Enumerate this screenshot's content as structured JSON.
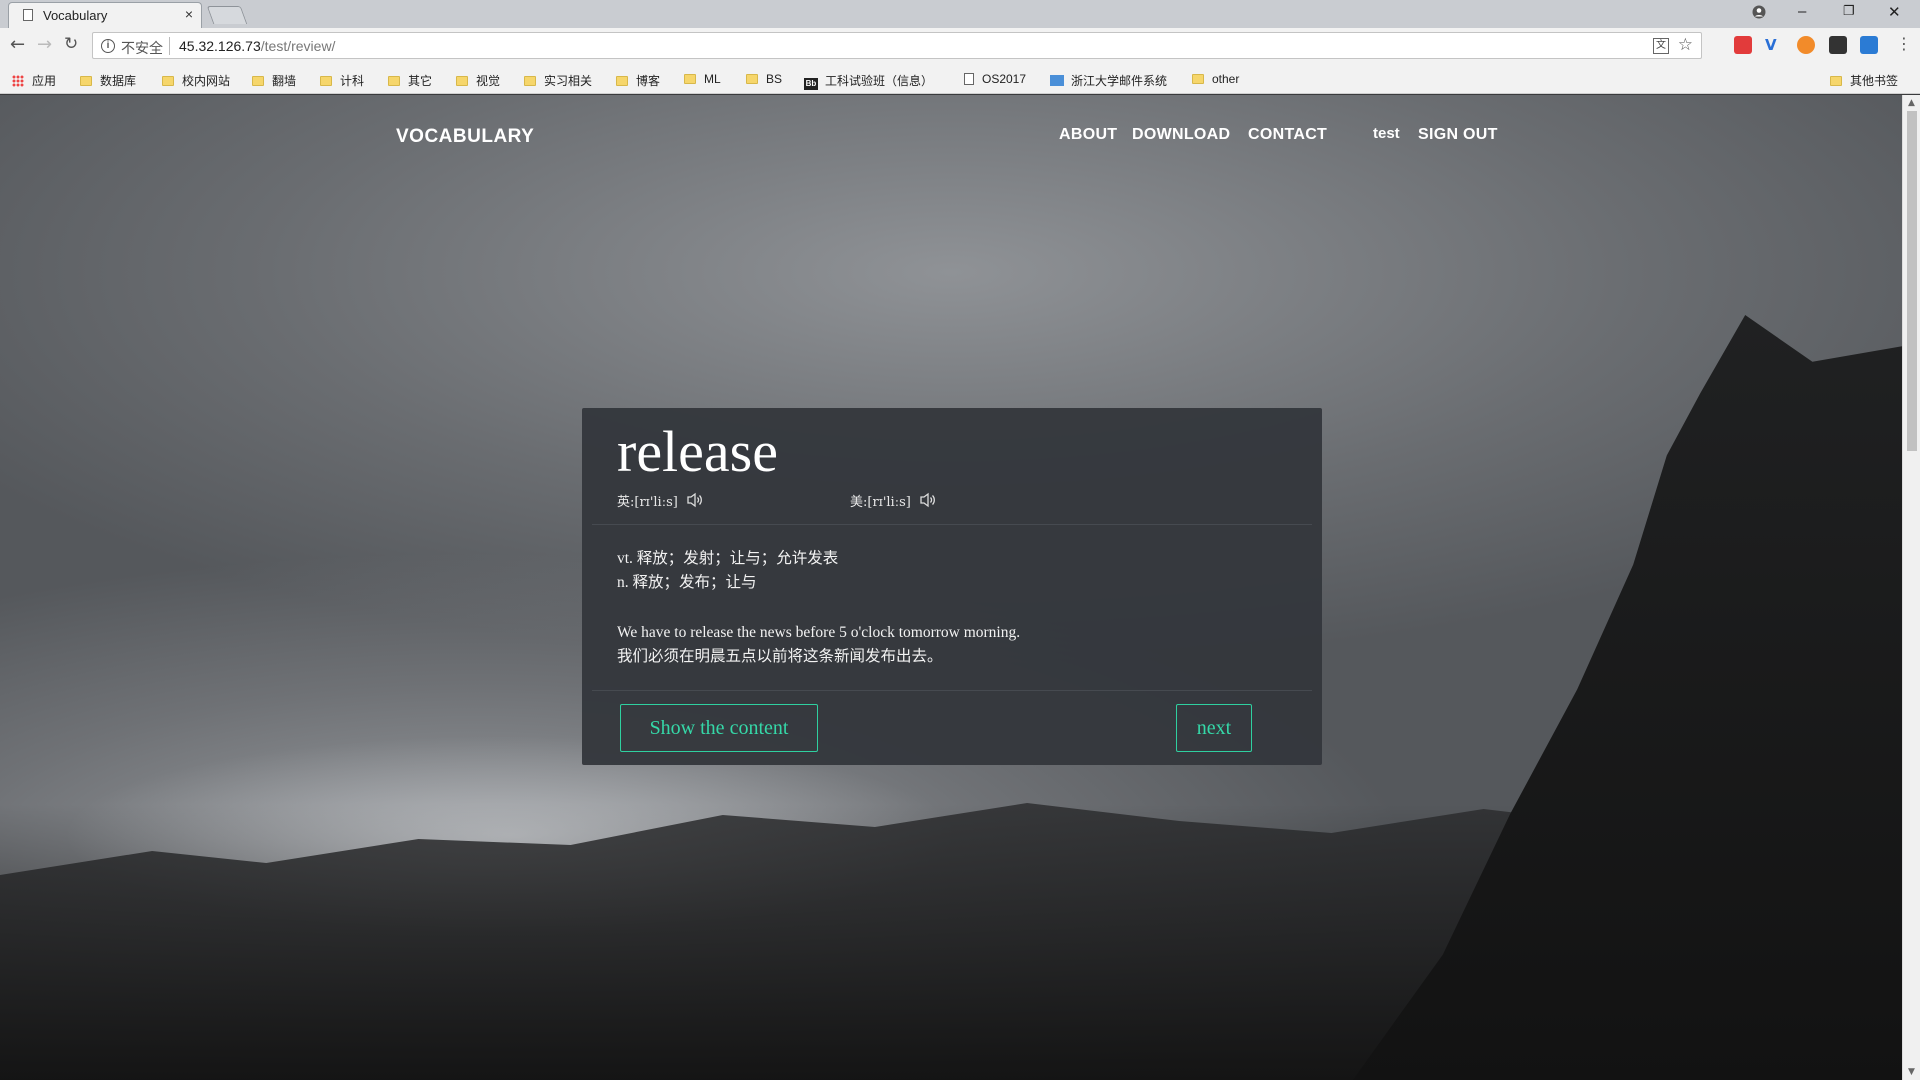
{
  "browser": {
    "tab_title": "Vocabulary",
    "tab_close": "×",
    "insecure_label": "不安全",
    "url_host": "45.32.126.73",
    "url_path": "/test/review/",
    "win_minimize": "–",
    "win_restore": "❐",
    "win_close": "✕"
  },
  "bookmarks": [
    {
      "label": "应用",
      "icon": "apps-icon"
    },
    {
      "label": "数据库",
      "icon": "folder-icon"
    },
    {
      "label": "校内网站",
      "icon": "folder-icon"
    },
    {
      "label": "翻墙",
      "icon": "folder-icon"
    },
    {
      "label": "计科",
      "icon": "folder-icon"
    },
    {
      "label": "其它",
      "icon": "folder-icon"
    },
    {
      "label": "视觉",
      "icon": "folder-icon"
    },
    {
      "label": "实习相关",
      "icon": "folder-icon"
    },
    {
      "label": "博客",
      "icon": "folder-icon"
    },
    {
      "label": "ML",
      "icon": "folder-icon"
    },
    {
      "label": "BS",
      "icon": "folder-icon"
    },
    {
      "label": "工科试验班（信息）",
      "icon": "bb-icon"
    },
    {
      "label": "OS2017",
      "icon": "page-icon"
    },
    {
      "label": "浙江大学邮件系统",
      "icon": "mail-icon"
    },
    {
      "label": "other",
      "icon": "folder-icon"
    },
    {
      "label": "其他书签",
      "icon": "folder-icon"
    }
  ],
  "site": {
    "brand": "VOCABULARY",
    "nav": {
      "about": "ABOUT",
      "download": "DOWNLOAD",
      "contact": "CONTACT",
      "user": "test",
      "signout": "SIGN OUT"
    }
  },
  "card": {
    "word": "release",
    "phonetic_uk": "英:[rɪ'liːs]",
    "phonetic_us": "美:[rɪ'liːs]",
    "definitions": [
      "vt. 释放；发射；让与；允许发表",
      "n. 释放；发布；让与"
    ],
    "example_en": "We have to release the news before 5 o'clock tomorrow morning.",
    "example_zh": "我们必须在明晨五点以前将这条新闻发布出去。",
    "show_button": "Show the content",
    "next_button": "next",
    "accent_color": "#35d8a8"
  }
}
